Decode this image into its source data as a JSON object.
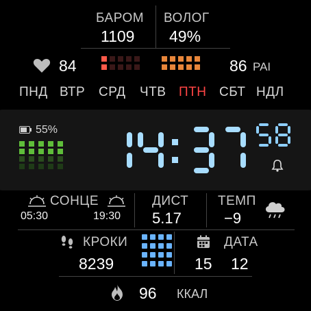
{
  "barometer": {
    "label": "БАРОМ",
    "value": "1109"
  },
  "humidity": {
    "label": "ВОЛОГ",
    "value": "49%"
  },
  "heart_rate": {
    "value": "84",
    "icon": "heart-icon"
  },
  "pai": {
    "value": "86",
    "unit": "PAI"
  },
  "weekdays": [
    {
      "label": "ПНД",
      "active": false
    },
    {
      "label": "ВТР",
      "active": false
    },
    {
      "label": "СРД",
      "active": false
    },
    {
      "label": "ЧТВ",
      "active": false
    },
    {
      "label": "ПТН",
      "active": true
    },
    {
      "label": "СБТ",
      "active": false
    },
    {
      "label": "НДЛ",
      "active": false
    }
  ],
  "battery": {
    "percent": "55%",
    "level": 0.55
  },
  "time": {
    "hours": "14",
    "minutes": "37",
    "seconds": "58"
  },
  "alarm": {
    "icon": "bell-icon"
  },
  "sun": {
    "label": "СОНЦЕ",
    "sunrise": "05:30",
    "sunset": "19:30"
  },
  "distance": {
    "label": "ДИСТ",
    "value": "5.17"
  },
  "temperature": {
    "label": "ТЕМП",
    "value": "−9",
    "icon": "rain-cloud-icon"
  },
  "steps": {
    "label": "КРОКИ",
    "value": "8239"
  },
  "date": {
    "label": "ДАТА",
    "day": "15",
    "month": "12"
  },
  "calories": {
    "value": "96",
    "unit": "ККАЛ"
  },
  "colors": {
    "accent_red": "#ff4545",
    "digit_blue": "#a8ddff",
    "green": "#5fbe3a",
    "orange": "#e8863a"
  }
}
